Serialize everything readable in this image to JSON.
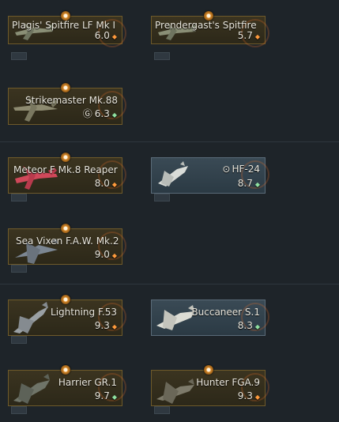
{
  "vehicles": [
    {
      "name": "Plagis' Spitfire LF Mk I",
      "br": "6.0",
      "rank_icon": "orange-diamond-icon",
      "premium": true
    },
    {
      "name": "Prendergast's Spitfire",
      "br": "5.7",
      "rank_icon": "orange-diamond-icon",
      "premium": true
    },
    {
      "name": "Strikemaster Mk.88",
      "br": "6.3",
      "rank_icon": "green-diamond-icon",
      "premium": true,
      "prefix_icon": "gaijin-coin-icon",
      "prefix": "Ⓖ"
    },
    {
      "name": "Meteor F Mk.8 Reaper",
      "br": "8.0",
      "rank_icon": "orange-diamond-icon",
      "premium": true
    },
    {
      "name": "HF-24",
      "br": "8.7",
      "rank_icon": "green-diamond-icon",
      "premium": false,
      "prefix_icon": "squadron-icon",
      "prefix": "⊙"
    },
    {
      "name": "Sea Vixen F.A.W. Mk.2",
      "br": "9.0",
      "rank_icon": "orange-diamond-icon",
      "premium": true
    },
    {
      "name": "Lightning F.53",
      "br": "9.3",
      "rank_icon": "orange-diamond-icon",
      "premium": true
    },
    {
      "name": "Buccaneer S.1",
      "br": "8.3",
      "rank_icon": "green-diamond-icon",
      "premium": false
    },
    {
      "name": "Harrier GR.1",
      "br": "9.7",
      "rank_icon": "green-diamond-icon",
      "premium": true
    },
    {
      "name": "Hunter FGA.9",
      "br": "9.3",
      "rank_icon": "orange-diamond-icon",
      "premium": true
    }
  ],
  "colors": {
    "premium_border": "#6e5a2a",
    "premium_bg": "#3b3420",
    "researched_bg": "#3a4a55",
    "rank_orange": "#ff9a3c",
    "rank_green": "#8fe0a0"
  }
}
